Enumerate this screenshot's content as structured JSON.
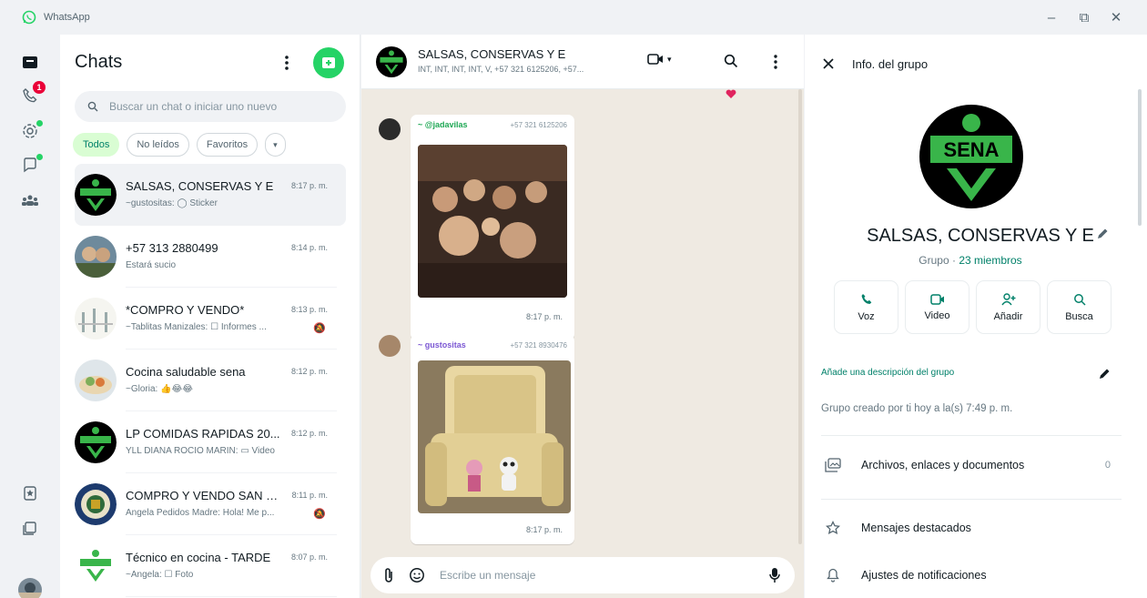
{
  "window": {
    "title": "WhatsApp",
    "minimize": "–",
    "maximize": "⧉",
    "close": "✕"
  },
  "rail": {
    "calls_badge": "1"
  },
  "chatlist": {
    "title": "Chats",
    "search_placeholder": "Buscar un chat o iniciar uno nuevo",
    "filters": [
      "Todos",
      "No leídos",
      "Favoritos"
    ],
    "items": [
      {
        "name": "SALSAS, CONSERVAS Y E",
        "time": "8:17 p. m.",
        "preview": "~gustositas: ◯ Sticker"
      },
      {
        "name": "+57 313 2880499",
        "time": "8:14 p. m.",
        "preview": "Estará sucio"
      },
      {
        "name": "*COMPRO Y VENDO*",
        "time": "8:13 p. m.",
        "preview": "~Tablitas Manizales: ☐ Informes ..."
      },
      {
        "name": "Cocina saludable sena",
        "time": "8:12 p. m.",
        "preview": "~Gloria: 👍😂😂"
      },
      {
        "name": "LP COMIDAS RAPIDAS 20...",
        "time": "8:12 p. m.",
        "preview": "YLL DIANA ROCIO MARIN: ▭ Video"
      },
      {
        "name": "COMPRO Y VENDO SAN L...",
        "time": "8:11 p. m.",
        "preview": "Angela Pedidos Madre: Hola! Me p..."
      },
      {
        "name": "Técnico en cocina - TARDE",
        "time": "8:07 p. m.",
        "preview": "~Angela: ☐ Foto"
      }
    ]
  },
  "conversation": {
    "name": "SALSAS, CONSERVAS Y E",
    "subtitle": "INT, INT, INT, INT, V, +57 321 6125206, +57...",
    "messages": [
      {
        "sender": "~ @jadavilas",
        "phone": "+57 321 6125206",
        "time": "8:17 p. m."
      },
      {
        "sender": "~ gustositas",
        "phone": "+57 321 8930476",
        "time": "8:17 p. m."
      }
    ],
    "composer_placeholder": "Escribe un mensaje"
  },
  "info": {
    "header": "Info. del grupo",
    "group_name": "SALSAS, CONSERVAS Y E",
    "group_label": "Grupo",
    "members": "23 miembros",
    "actions": [
      "Voz",
      "Video",
      "Añadir",
      "Busca"
    ],
    "add_description": "Añade una descripción del grupo",
    "created": "Grupo creado por ti hoy a la(s) 7:49 p. m.",
    "files_label": "Archivos, enlaces y documentos",
    "files_count": "0",
    "starred": "Mensajes destacados",
    "notifications": "Ajustes de notificaciones"
  },
  "logo_text": "SENA",
  "colors": {
    "accent": "#25d366",
    "teal": "#008069",
    "sena_green": "#39b54a"
  }
}
